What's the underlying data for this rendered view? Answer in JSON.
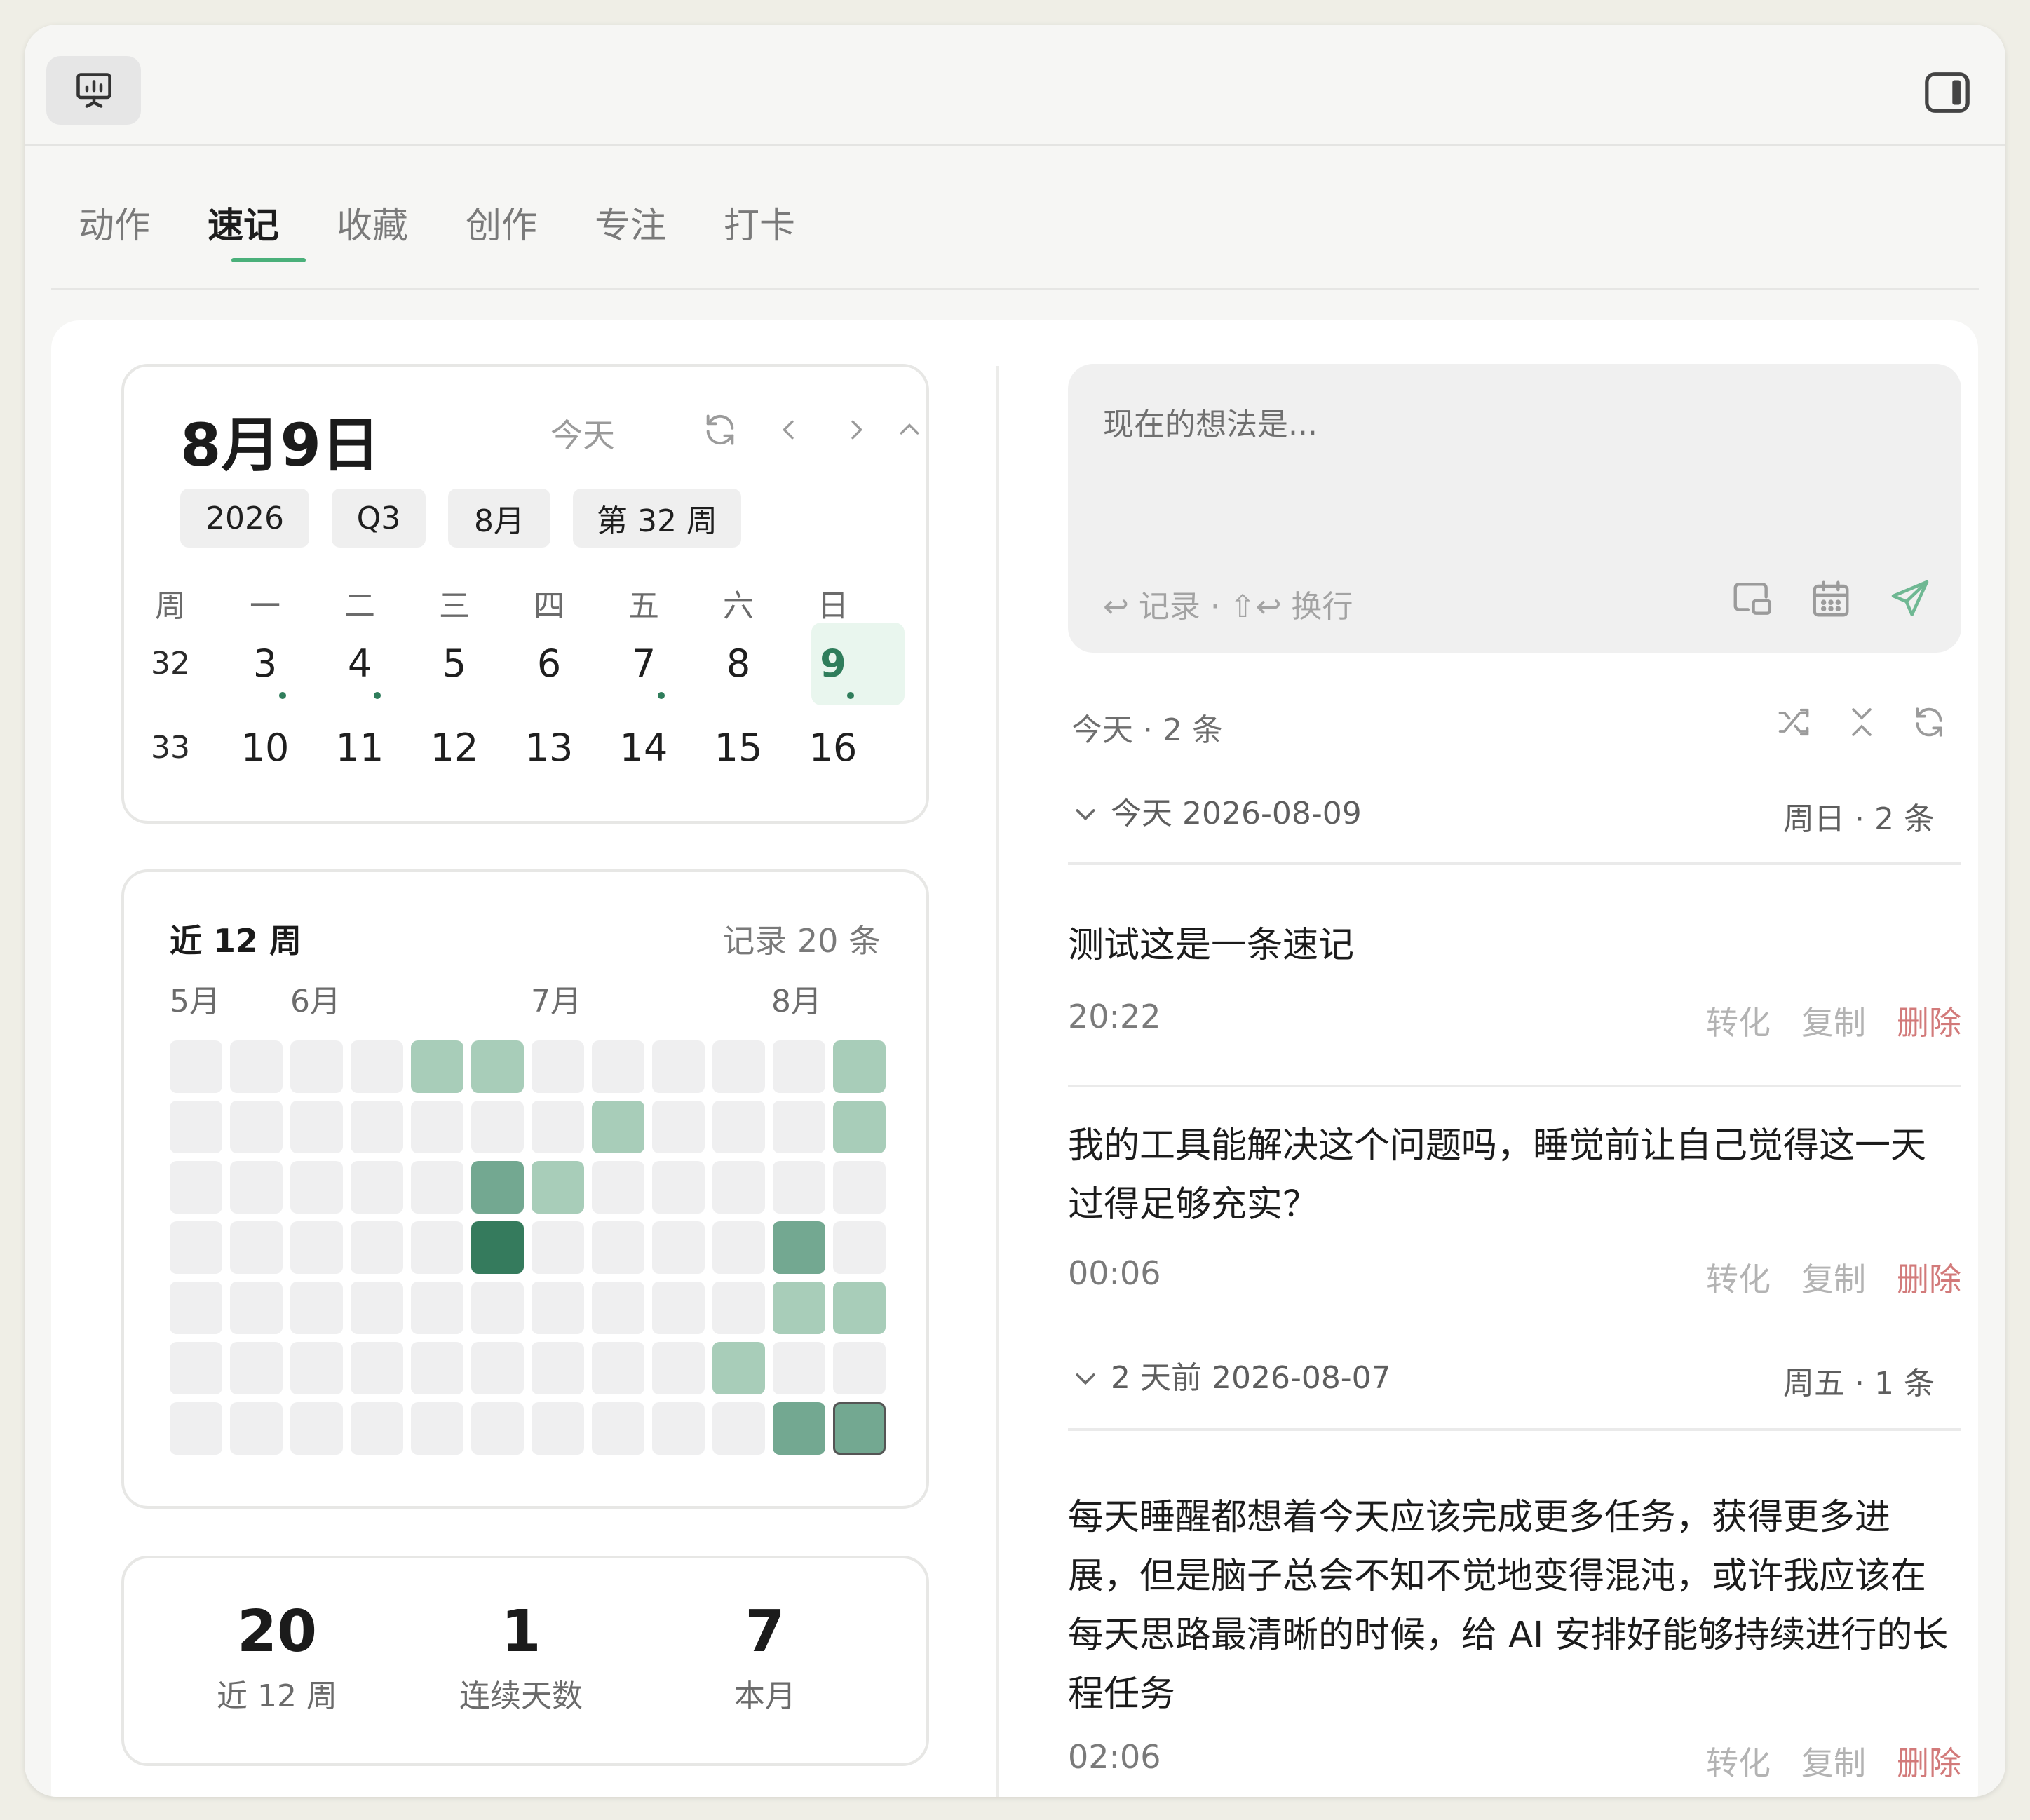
{
  "tabs": [
    "动作",
    "速记",
    "收藏",
    "创作",
    "专注",
    "打卡"
  ],
  "icons": {
    "app": "presentation-chart-icon",
    "sidebar": "sidebar-toggle-icon",
    "refresh": "refresh-icon",
    "prev": "chevron-left-icon",
    "next": "chevron-right-icon",
    "collapse": "chevron-up-icon",
    "screen": "screen-icon",
    "calendar": "calendar-icon",
    "send": "send-icon",
    "shuffle": "shuffle-icon",
    "collapse_all": "collapse-all-icon"
  },
  "colors": {
    "accent": "#4ab07a",
    "dark_green": "#2f7d5b",
    "delete": "#d27a7a"
  },
  "calendar": {
    "title": "8月9日",
    "today": "今天",
    "chips": [
      "2026",
      "Q3",
      "8月",
      "第 32 周"
    ],
    "weekday_header": [
      "周",
      "一",
      "二",
      "三",
      "四",
      "五",
      "六",
      "日"
    ],
    "weeks": [
      {
        "week": "32",
        "days": [
          "3",
          "4",
          "5",
          "6",
          "7",
          "8",
          "9"
        ],
        "has_note": [
          true,
          true,
          false,
          false,
          true,
          false,
          true
        ]
      },
      {
        "week": "33",
        "days": [
          "10",
          "11",
          "12",
          "13",
          "14",
          "15",
          "16"
        ],
        "has_note": [
          false,
          false,
          false,
          false,
          false,
          false,
          false
        ]
      }
    ],
    "selected_day": "9"
  },
  "heatmap": {
    "title": "近 12 周",
    "count_text": "记录 20 条",
    "months": [
      "5月",
      "6月",
      "7月",
      "8月"
    ],
    "levels": [
      [
        0,
        0,
        0,
        0,
        1,
        1,
        0,
        0,
        0,
        0,
        0,
        1
      ],
      [
        0,
        0,
        0,
        0,
        0,
        0,
        0,
        1,
        0,
        0,
        0,
        1
      ],
      [
        0,
        0,
        0,
        0,
        0,
        2,
        1,
        0,
        0,
        0,
        0,
        0
      ],
      [
        0,
        0,
        0,
        0,
        0,
        3,
        0,
        0,
        0,
        0,
        2,
        0
      ],
      [
        0,
        0,
        0,
        0,
        0,
        0,
        0,
        0,
        0,
        0,
        1,
        1
      ],
      [
        0,
        0,
        0,
        0,
        0,
        0,
        0,
        0,
        0,
        1,
        0,
        0
      ],
      [
        0,
        0,
        0,
        0,
        0,
        0,
        0,
        0,
        0,
        0,
        2,
        2
      ]
    ]
  },
  "stats": [
    {
      "value": "20",
      "label": "近 12 周"
    },
    {
      "value": "1",
      "label": "连续天数"
    },
    {
      "value": "7",
      "label": "本月"
    }
  ],
  "composer": {
    "placeholder": "现在的想法是...",
    "hint": "↩ 记录 · ⇧↩ 换行"
  },
  "list": {
    "summary": "今天 · 2 条",
    "groups": [
      {
        "label": "今天 2026-08-09",
        "right": "周日 · 2 条",
        "entries": [
          {
            "text": "测试这是一条速记",
            "time": "20:22"
          },
          {
            "text": "我的工具能解决这个问题吗，睡觉前让自己觉得这一天过得足够充实？",
            "time": "00:06"
          }
        ]
      },
      {
        "label": "2 天前 2026-08-07",
        "right": "周五 · 1 条",
        "entries": [
          {
            "text": "每天睡醒都想着今天应该完成更多任务，获得更多进展，但是脑子总会不知不觉地变得混沌，或许我应该在每天思路最清晰的时候，给 AI 安排好能够持续进行的长程任务",
            "time": "02:06"
          }
        ]
      }
    ],
    "actions": {
      "convert": "转化",
      "copy": "复制",
      "delete": "删除"
    }
  }
}
